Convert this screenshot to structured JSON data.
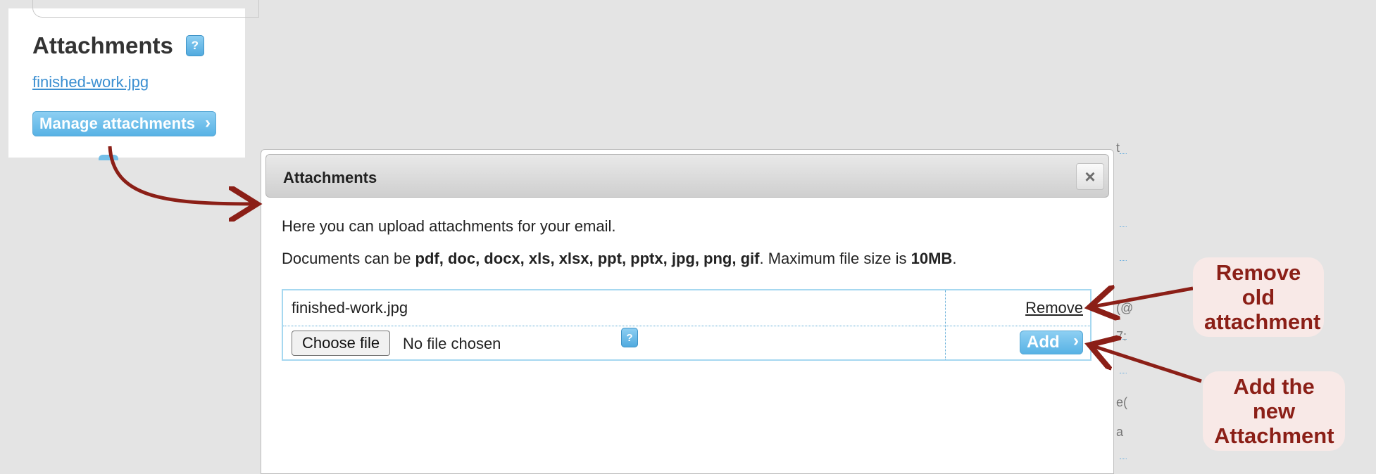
{
  "left_panel": {
    "title": "Attachments",
    "help_icon": "?",
    "file_link": "finished-work.jpg",
    "manage_button": "Manage attachments",
    "chevron": "›"
  },
  "dialog": {
    "title": "Attachments",
    "close_icon": "×",
    "intro_text": "Here you can upload attachments for your email.",
    "formats_prefix": "Documents can be ",
    "formats_list": "pdf, doc, docx, xls, xlsx, ppt, pptx, jpg, png, gif",
    "formats_middle": ". Maximum file size is ",
    "max_size": "10MB",
    "formats_suffix": ".",
    "attachments": [
      {
        "file": "finished-work.jpg",
        "action": "Remove"
      }
    ],
    "upload_row": {
      "choose_button": "Choose file",
      "no_file_text": "No file chosen",
      "help_icon": "?",
      "add_button": "Add",
      "chevron": "›"
    }
  },
  "annotations": {
    "remove_callout": "Remove old attachment",
    "add_callout": "Add the new Attachment",
    "arrow_color": "#8b1f17"
  },
  "background_fragments": [
    "t",
    "(@",
    "7:",
    "e(",
    "a"
  ]
}
